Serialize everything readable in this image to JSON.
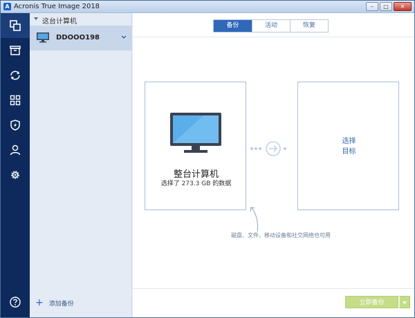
{
  "window": {
    "title": "Acronis True Image 2018",
    "logo_letter": "A",
    "minimize_label": "–",
    "maximize_label": "□",
    "close_label": "✕"
  },
  "nav": {
    "items": [
      {
        "name": "backup",
        "icon": "copy-icon",
        "active": true
      },
      {
        "name": "archive",
        "icon": "archive-icon"
      },
      {
        "name": "sync",
        "icon": "sync-icon"
      },
      {
        "name": "tools",
        "icon": "grid-icon"
      },
      {
        "name": "protection",
        "icon": "shield-icon"
      },
      {
        "name": "account",
        "icon": "user-icon"
      },
      {
        "name": "settings",
        "icon": "gear-icon"
      }
    ],
    "help_icon": "help-icon"
  },
  "sources": {
    "header_label": "这台计算机",
    "selected_item": "DDOOO198",
    "add_backup_label": "添加备份"
  },
  "tabs": [
    {
      "label": "备份",
      "active": true
    },
    {
      "label": "活动",
      "active": false
    },
    {
      "label": "恢复",
      "active": false
    }
  ],
  "source_card": {
    "title": "整台计算机",
    "subtitle": "选择了 273.3 GB 的数据"
  },
  "dest_card": {
    "line1": "选择",
    "line2": "目标"
  },
  "hint_text": "磁盘、文件、移动设备和社交网络也可用",
  "backup_button_label": "立即备份",
  "colors": {
    "nav_bg": "#0e2a5c",
    "accent": "#2f67b9",
    "button_green": "#c5dc88"
  }
}
